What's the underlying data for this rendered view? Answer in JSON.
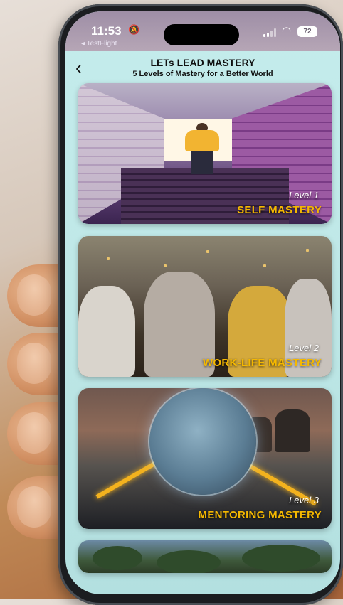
{
  "status_bar": {
    "time": "11:53",
    "back_app": "◂ TestFlight",
    "battery": "72"
  },
  "header": {
    "back_icon": "chevron-left-icon",
    "title": "LETs LEAD MASTERY",
    "subtitle": "5 Levels of Mastery for a Better World"
  },
  "levels": [
    {
      "level": "Level 1",
      "title": "SELF MASTERY"
    },
    {
      "level": "Level 2",
      "title": "WORK-LIFE MASTERY"
    },
    {
      "level": "Level 3",
      "title": "MENTORING MASTERY"
    }
  ],
  "colors": {
    "accent_title": "#f5b800",
    "screen_bg": "#c4ecec"
  }
}
